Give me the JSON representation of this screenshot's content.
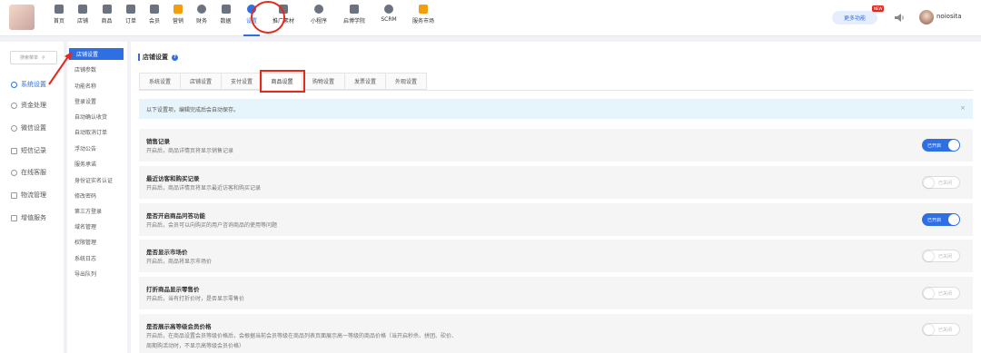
{
  "topnav": {
    "items": [
      {
        "label": "首页",
        "icon": "home-icon"
      },
      {
        "label": "店铺",
        "icon": "shop-icon"
      },
      {
        "label": "商品",
        "icon": "goods-icon"
      },
      {
        "label": "订单",
        "icon": "order-icon"
      },
      {
        "label": "会员",
        "icon": "member-icon"
      },
      {
        "label": "营销",
        "icon": "marketing-icon"
      },
      {
        "label": "财务",
        "icon": "finance-icon"
      },
      {
        "label": "数据",
        "icon": "data-icon"
      },
      {
        "label": "设置",
        "icon": "settings-icon"
      },
      {
        "label": "推广素材",
        "icon": "share-icon"
      },
      {
        "label": "小程序",
        "icon": "miniapp-icon"
      },
      {
        "label": "启博学院",
        "icon": "academy-icon"
      },
      {
        "label": "SCRM",
        "icon": "scrm-icon"
      },
      {
        "label": "服务市场",
        "icon": "market-icon"
      }
    ],
    "more_label": "更多功能",
    "new_badge": "NEW",
    "username": "noiosita"
  },
  "sidebar": {
    "search_placeholder": "搜索菜单",
    "items": [
      {
        "label": "系统设置"
      },
      {
        "label": "资金处理"
      },
      {
        "label": "微信设置"
      },
      {
        "label": "短信记录"
      },
      {
        "label": "在线客服"
      },
      {
        "label": "物流管理"
      },
      {
        "label": "增值服务"
      }
    ]
  },
  "submenu": {
    "items": [
      {
        "label": "店铺设置"
      },
      {
        "label": "店铺参数"
      },
      {
        "label": "功能名称"
      },
      {
        "label": "登录设置"
      },
      {
        "label": "自动确认收货"
      },
      {
        "label": "自动取消订单"
      },
      {
        "label": "浮动公告"
      },
      {
        "label": "服务承诺"
      },
      {
        "label": "身份证实名认证"
      },
      {
        "label": "修改密码"
      },
      {
        "label": "第三方登录"
      },
      {
        "label": "域名管理"
      },
      {
        "label": "权限管理"
      },
      {
        "label": "系统日志"
      },
      {
        "label": "导出队列"
      }
    ]
  },
  "main": {
    "title": "店铺设置",
    "tabs": [
      {
        "label": "系统设置"
      },
      {
        "label": "店铺设置"
      },
      {
        "label": "支付设置"
      },
      {
        "label": "商品设置"
      },
      {
        "label": "购物设置"
      },
      {
        "label": "发票设置"
      },
      {
        "label": "外观设置"
      }
    ],
    "notice": "以下设置项，编辑完成后会自动保存。",
    "settings": [
      {
        "title": "销售记录",
        "desc": "开启后，商品详情页将显示销售记录",
        "state": "已开启",
        "on": true
      },
      {
        "title": "最近访客和购买记录",
        "desc": "开启后，商品详情页将显示最近访客和购买记录",
        "state": "已关闭",
        "on": false
      },
      {
        "title": "是否开启商品问答功能",
        "desc": "开启后，会员可以向购买的用户咨询商品的使用等问题",
        "state": "已开启",
        "on": true
      },
      {
        "title": "是否显示市场价",
        "desc": "开启后，商品将显示市场价",
        "state": "已关闭",
        "on": false
      },
      {
        "title": "打折商品显示零售价",
        "desc": "开启后，当有打折价时，是否显示零售价",
        "state": "已关闭",
        "on": false
      },
      {
        "title": "是否展示高等级会员价格",
        "desc": "开启后，在商品设置会员等级价格后，会根据当前会员等级在商品列表页面展示高一等级的商品价格（当开启秒杀、拼团、砍价、",
        "desc2": "周期购活动时，不显示高等级会员价格）",
        "state": "已关闭",
        "on": false
      }
    ]
  },
  "colors": {
    "accent": "#2f6fe4",
    "annotation": "#e4291d",
    "notice_bg": "#e6f5fc"
  }
}
